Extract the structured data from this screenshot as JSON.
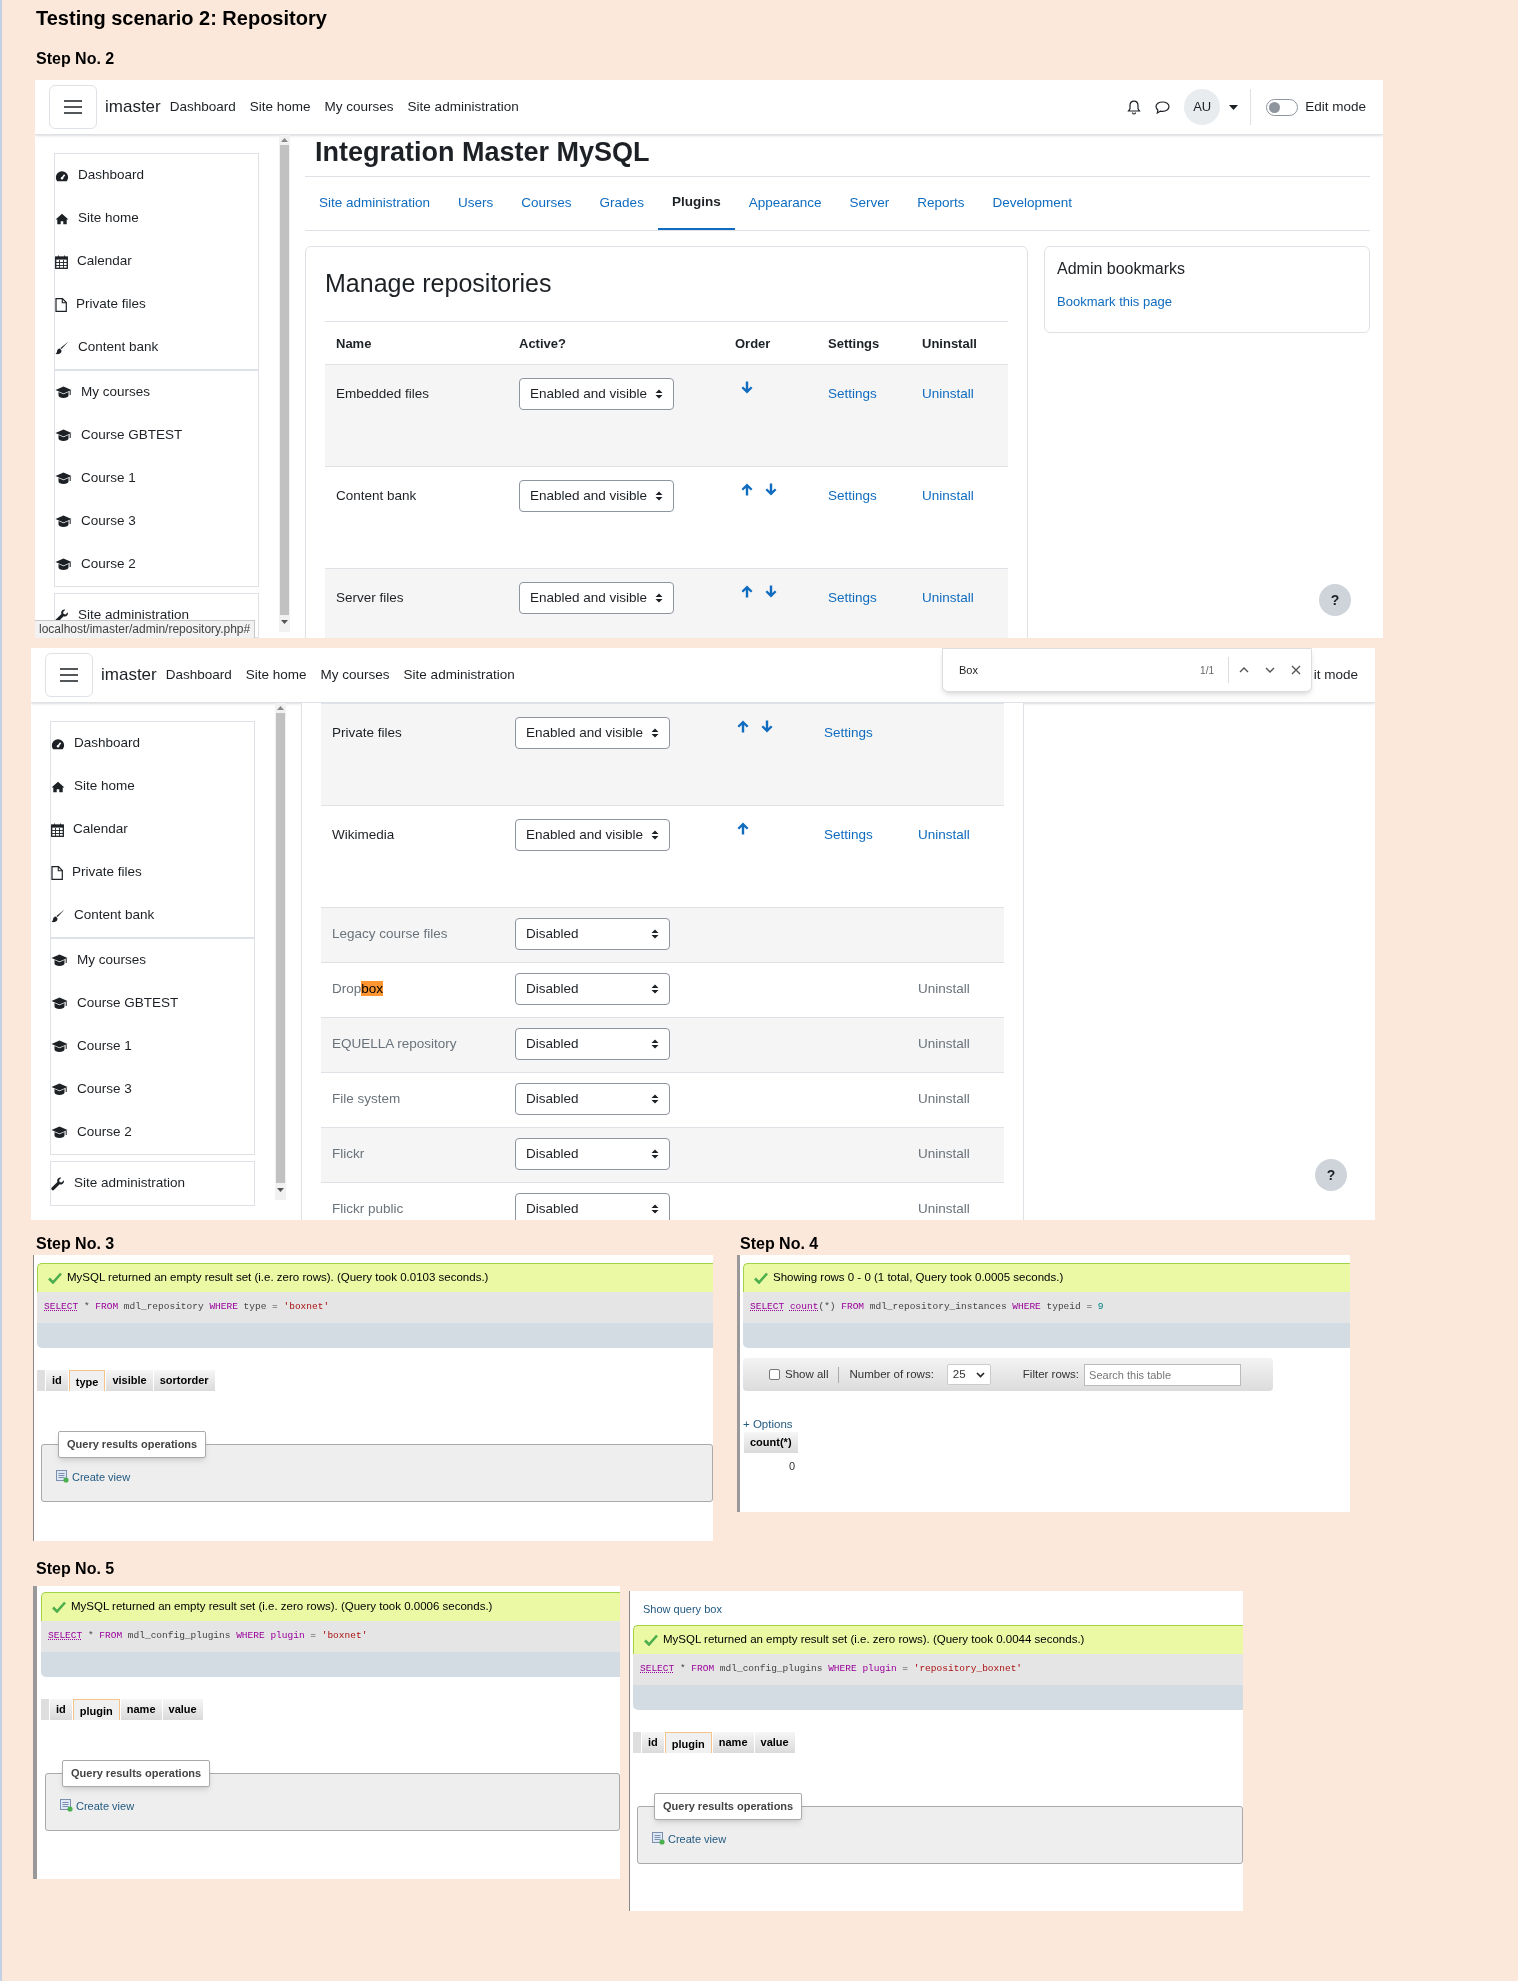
{
  "title": "Testing scenario 2: Repository",
  "steps": [
    {
      "label": "Step No. 2",
      "screens": [
        {
          "kind": "moodle",
          "brand": "imaster",
          "nav_links": [
            "Dashboard",
            "Site home",
            "My courses",
            "Site administration"
          ],
          "avatar": "AU",
          "edit_mode": {
            "label": "Edit mode",
            "on": false
          },
          "sidebar": [
            {
              "label": "Dashboard"
            },
            {
              "label": "Site home"
            },
            {
              "label": "Calendar"
            },
            {
              "label": "Private files"
            },
            {
              "label": "Content bank"
            },
            {
              "label": "My courses",
              "children": [
                {
                  "label": "Course GBTEST"
                },
                {
                  "label": "Course 1"
                },
                {
                  "label": "Course 3"
                },
                {
                  "label": "Course 2"
                }
              ]
            },
            {
              "label": "Site administration"
            }
          ],
          "heading": "Integration Master MySQL",
          "tabs": [
            {
              "label": "Site administration",
              "selected": false
            },
            {
              "label": "Users",
              "selected": false
            },
            {
              "label": "Courses",
              "selected": false
            },
            {
              "label": "Grades",
              "selected": false
            },
            {
              "label": "Plugins",
              "selected": true
            },
            {
              "label": "Appearance",
              "selected": false
            },
            {
              "label": "Server",
              "selected": false
            },
            {
              "label": "Reports",
              "selected": false
            },
            {
              "label": "Development",
              "selected": false
            }
          ],
          "card_title": "Manage repositories",
          "columns": [
            "Name",
            "Active?",
            "Order",
            "Settings",
            "Uninstall"
          ],
          "rows": [
            {
              "name": "Embedded files",
              "enabled": true,
              "active": "Enabled and visible",
              "up": false,
              "down": true,
              "settings": "Settings",
              "uninstall": "Uninstall"
            },
            {
              "name": "Content bank",
              "enabled": true,
              "active": "Enabled and visible",
              "up": true,
              "down": true,
              "settings": "Settings",
              "uninstall": "Uninstall"
            },
            {
              "name": "Server files",
              "enabled": true,
              "active": "Enabled and visible",
              "up": true,
              "down": true,
              "settings": "Settings",
              "uninstall": "Uninstall"
            }
          ],
          "bookmarks": {
            "title": "Admin bookmarks",
            "link": "Bookmark this page"
          },
          "status_url": "localhost/imaster/admin/repository.php#",
          "help": "?"
        },
        {
          "kind": "moodle",
          "brand": "imaster",
          "nav_links": [
            "Dashboard",
            "Site home",
            "My courses",
            "Site administration"
          ],
          "edit_mode": {
            "label": "it mode"
          },
          "find_bar": {
            "query": "Box",
            "count": "1/1"
          },
          "sidebar": [
            {
              "label": "Dashboard"
            },
            {
              "label": "Site home"
            },
            {
              "label": "Calendar"
            },
            {
              "label": "Private files"
            },
            {
              "label": "Content bank"
            },
            {
              "label": "My courses",
              "children": [
                {
                  "label": "Course GBTEST"
                },
                {
                  "label": "Course 1"
                },
                {
                  "label": "Course 3"
                },
                {
                  "label": "Course 2"
                }
              ]
            },
            {
              "label": "Site administration"
            }
          ],
          "rows": [
            {
              "name": "Private files",
              "enabled": true,
              "active": "Enabled and visible",
              "up": true,
              "down": true,
              "settings": "Settings"
            },
            {
              "name": "Wikimedia",
              "enabled": true,
              "active": "Enabled and visible",
              "up": true,
              "down": false,
              "settings": "Settings",
              "uninstall": "Uninstall"
            },
            {
              "name": "Legacy course files",
              "enabled": false,
              "active": "Disabled"
            },
            {
              "name_parts": [
                {
                  "text": "Drop",
                  "highlighted": false
                },
                {
                  "text": "box",
                  "highlighted": true
                }
              ],
              "enabled": false,
              "active": "Disabled",
              "uninstall": "Uninstall"
            },
            {
              "name": "EQUELLA repository",
              "enabled": false,
              "active": "Disabled",
              "uninstall": "Uninstall"
            },
            {
              "name": "File system",
              "enabled": false,
              "active": "Disabled",
              "uninstall": "Uninstall"
            },
            {
              "name": "Flickr",
              "enabled": false,
              "active": "Disabled",
              "uninstall": "Uninstall"
            },
            {
              "name": "Flickr public",
              "enabled": false,
              "active": "Disabled",
              "uninstall": "Uninstall"
            }
          ],
          "help": "?"
        }
      ]
    },
    {
      "label": "Step No. 3",
      "screens": [
        {
          "kind": "pma",
          "message": "MySQL returned an empty result set (i.e. zero rows). (Query took 0.0103 seconds.)",
          "sql": [
            {
              "text": "SELECT",
              "kind": "doc_keyword"
            },
            {
              "text": " * ",
              "kind": "plain"
            },
            {
              "text": "FROM",
              "kind": "keyword"
            },
            {
              "text": " mdl_repository ",
              "kind": "plain"
            },
            {
              "text": "WHERE",
              "kind": "keyword"
            },
            {
              "text": " type = ",
              "kind": "plain"
            },
            {
              "text": "'boxnet'",
              "kind": "string"
            }
          ],
          "columns": [
            {
              "label": "id",
              "highlighted": false
            },
            {
              "label": "type",
              "highlighted": true
            },
            {
              "label": "visible",
              "highlighted": false
            },
            {
              "label": "sortorder",
              "highlighted": false
            }
          ],
          "operations": {
            "legend": "Query results operations",
            "link": "Create view"
          }
        }
      ]
    },
    {
      "label": "Step No. 4",
      "screens": [
        {
          "kind": "pma",
          "message": "Showing rows 0 - 0 (1 total, Query took 0.0005 seconds.)",
          "sql": [
            {
              "text": "SELECT",
              "kind": "doc_keyword"
            },
            {
              "text": " count",
              "kind": "doc_keyword"
            },
            {
              "text": "(*) ",
              "kind": "plain"
            },
            {
              "text": "FROM",
              "kind": "keyword"
            },
            {
              "text": " mdl_repository_instances ",
              "kind": "plain"
            },
            {
              "text": "WHERE",
              "kind": "keyword"
            },
            {
              "text": " typeid = ",
              "kind": "plain"
            },
            {
              "text": "9",
              "kind": "number"
            }
          ],
          "toolbar": {
            "show_all": {
              "label": "Show all",
              "checked": false
            },
            "rows_label": "Number of rows:",
            "rows_value": "25",
            "filter_label": "Filter rows:",
            "filter_placeholder": "Search this table"
          },
          "options_link": "+ Options",
          "columns": [
            {
              "label": "count(*)",
              "highlighted": false
            }
          ],
          "rows": [
            [
              "0"
            ]
          ]
        }
      ]
    },
    {
      "label": "Step No. 5",
      "screens": [
        {
          "kind": "pma",
          "message": "MySQL returned an empty result set (i.e. zero rows). (Query took 0.0006 seconds.)",
          "sql": [
            {
              "text": "SELECT",
              "kind": "doc_keyword"
            },
            {
              "text": " * ",
              "kind": "plain"
            },
            {
              "text": "FROM",
              "kind": "keyword"
            },
            {
              "text": " mdl_config_plugins ",
              "kind": "plain"
            },
            {
              "text": "WHERE",
              "kind": "keyword"
            },
            {
              "text": " plugin",
              "kind": "keyword"
            },
            {
              "text": " = ",
              "kind": "plain"
            },
            {
              "text": "'boxnet'",
              "kind": "string"
            }
          ],
          "columns": [
            {
              "label": "id",
              "highlighted": false
            },
            {
              "label": "plugin",
              "highlighted": true
            },
            {
              "label": "name",
              "highlighted": false
            },
            {
              "label": "value",
              "highlighted": false
            }
          ],
          "operations": {
            "legend": "Query results operations",
            "link": "Create view"
          }
        },
        {
          "kind": "pma",
          "show_query_link": "Show query box",
          "message": "MySQL returned an empty result set (i.e. zero rows). (Query took 0.0044 seconds.)",
          "sql": [
            {
              "text": "SELECT",
              "kind": "doc_keyword"
            },
            {
              "text": " * ",
              "kind": "plain"
            },
            {
              "text": "FROM",
              "kind": "keyword"
            },
            {
              "text": " mdl_config_plugins ",
              "kind": "plain"
            },
            {
              "text": "WHERE",
              "kind": "keyword"
            },
            {
              "text": " plugin",
              "kind": "keyword"
            },
            {
              "text": " = ",
              "kind": "plain"
            },
            {
              "text": "'repository_boxnet'",
              "kind": "string"
            }
          ],
          "columns": [
            {
              "label": "id",
              "highlighted": false
            },
            {
              "label": "plugin",
              "highlighted": true
            },
            {
              "label": "name",
              "highlighted": false
            },
            {
              "label": "value",
              "highlighted": false
            }
          ],
          "operations": {
            "legend": "Query results operations",
            "link": "Create view"
          }
        }
      ]
    }
  ]
}
